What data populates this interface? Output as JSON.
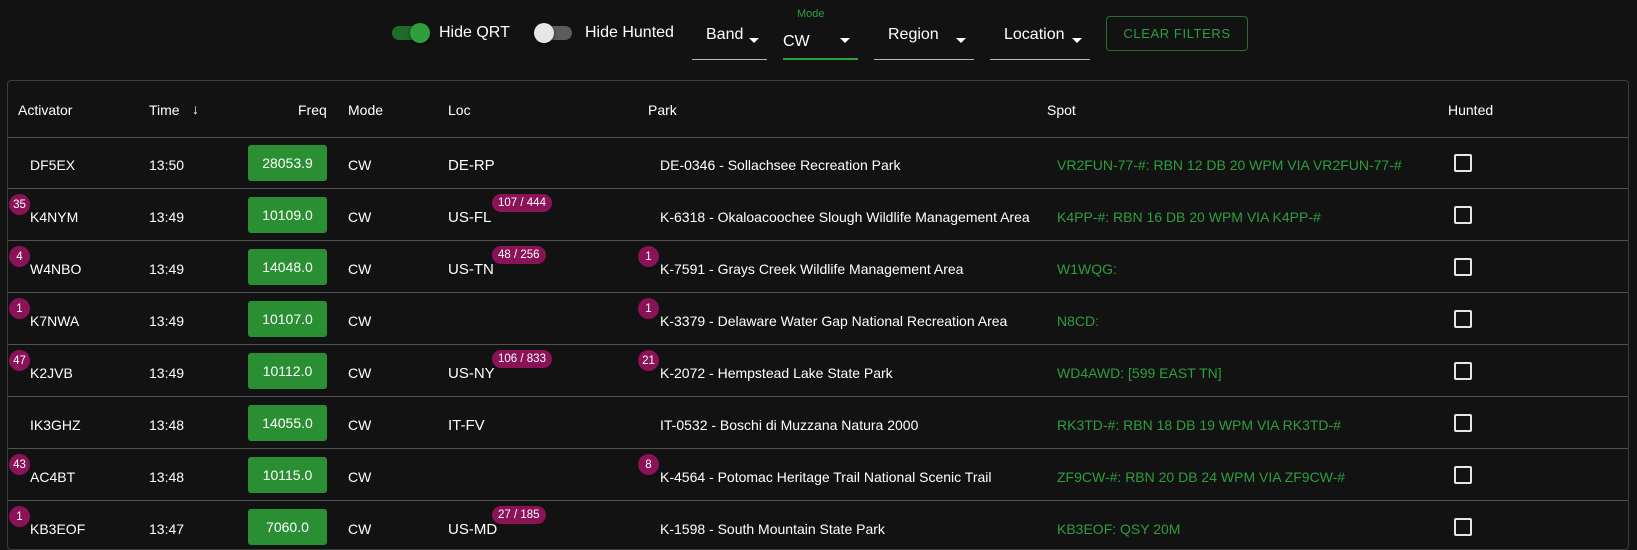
{
  "filters": {
    "hide_qrt": {
      "label": "Hide QRT",
      "on": true
    },
    "hide_hunted": {
      "label": "Hide Hunted",
      "on": false
    },
    "band": {
      "value": "Band"
    },
    "mode": {
      "label": "Mode",
      "value": "CW"
    },
    "region": {
      "value": "Region"
    },
    "location": {
      "value": "Location"
    },
    "clear_label": "CLEAR FILTERS"
  },
  "table": {
    "headers": {
      "activator": "Activator",
      "time": "Time",
      "freq": "Freq",
      "mode": "Mode",
      "loc": "Loc",
      "park": "Park",
      "spot": "Spot",
      "hunted": "Hunted"
    },
    "rows": [
      {
        "activator_badge": "",
        "activator": "DF5EX",
        "time": "13:50",
        "freq": "28053.9",
        "mode": "CW",
        "loc": "DE-RP",
        "loc_badge": "",
        "park_badge": "",
        "park": "DE-0346 - Sollachsee Recreation Park",
        "spot": "VR2FUN-77-#: RBN 12 DB 20 WPM VIA VR2FUN-77-#"
      },
      {
        "activator_badge": "35",
        "activator": "K4NYM",
        "time": "13:49",
        "freq": "10109.0",
        "mode": "CW",
        "loc": "US-FL",
        "loc_badge": "107 / 444",
        "park_badge": "",
        "park": "K-6318 - Okaloacoochee Slough Wildlife Management Area",
        "spot": "K4PP-#: RBN 16 DB 20 WPM VIA K4PP-#"
      },
      {
        "activator_badge": "4",
        "activator": "W4NBO",
        "time": "13:49",
        "freq": "14048.0",
        "mode": "CW",
        "loc": "US-TN",
        "loc_badge": "48 / 256",
        "park_badge": "1",
        "park": "K-7591 - Grays Creek Wildlife Management Area",
        "spot": "W1WQG:"
      },
      {
        "activator_badge": "1",
        "activator": "K7NWA",
        "time": "13:49",
        "freq": "10107.0",
        "mode": "CW",
        "loc": "",
        "loc_badge": "",
        "park_badge": "1",
        "park": "K-3379 - Delaware Water Gap National Recreation Area",
        "spot": "N8CD:"
      },
      {
        "activator_badge": "47",
        "activator": "K2JVB",
        "time": "13:49",
        "freq": "10112.0",
        "mode": "CW",
        "loc": "US-NY",
        "loc_badge": "106 / 833",
        "park_badge": "21",
        "park": "K-2072 - Hempstead Lake State Park",
        "spot": "WD4AWD: [599 EAST TN]"
      },
      {
        "activator_badge": "",
        "activator": "IK3GHZ",
        "time": "13:48",
        "freq": "14055.0",
        "mode": "CW",
        "loc": "IT-FV",
        "loc_badge": "",
        "park_badge": "",
        "park": "IT-0532 - Boschi di Muzzana Natura 2000",
        "spot": "RK3TD-#: RBN 18 DB 19 WPM VIA RK3TD-#"
      },
      {
        "activator_badge": "43",
        "activator": "AC4BT",
        "time": "13:48",
        "freq": "10115.0",
        "mode": "CW",
        "loc": "",
        "loc_badge": "",
        "park_badge": "8",
        "park": "K-4564 - Potomac Heritage Trail National Scenic Trail",
        "spot": "ZF9CW-#: RBN 20 DB 24 WPM VIA ZF9CW-#"
      },
      {
        "activator_badge": "1",
        "activator": "KB3EOF",
        "time": "13:47",
        "freq": "7060.0",
        "mode": "CW",
        "loc": "US-MD",
        "loc_badge": "27 / 185",
        "park_badge": "",
        "park": "K-1598 - South Mountain State Park",
        "spot": "KB3EOF: QSY 20M"
      }
    ]
  },
  "colors": {
    "accent_green": "#2e9e3e",
    "freq_green": "#2a8f33",
    "badge_magenta": "#8a1257",
    "background": "#121212"
  }
}
